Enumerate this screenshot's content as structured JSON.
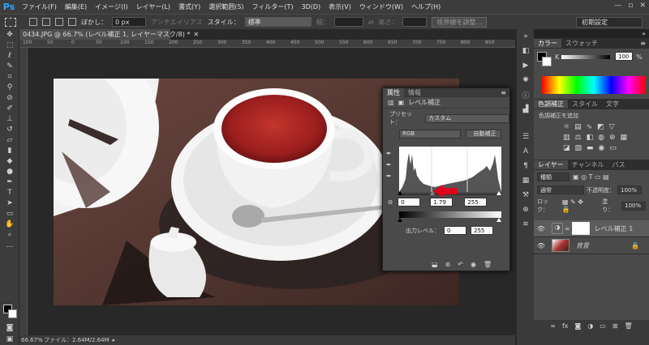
{
  "app": {
    "logo": "Ps"
  },
  "menu": [
    "ファイル(F)",
    "編集(E)",
    "イメージ(I)",
    "レイヤー(L)",
    "書式(Y)",
    "選択範囲(S)",
    "フィルター(T)",
    "3D(D)",
    "表示(V)",
    "ウィンドウ(W)",
    "ヘルプ(H)"
  ],
  "window_controls": [
    "—",
    "▫",
    "✕"
  ],
  "options": {
    "feather_label": "ぼかし：",
    "feather_value": "0 px",
    "antialias": "アンチエイリアス",
    "style_label": "スタイル：",
    "style_value": "標準",
    "width_label": "幅：",
    "height_label": "高さ：",
    "refine": "境界線を調整...",
    "workspace": "初期設定"
  },
  "document": {
    "tab": "0434.JPG @ 66.7% (レベル補正 1, レイヤーマスク/8) *",
    "status": "ファイル：2.64M/2.64M",
    "zoom": "66.67%"
  },
  "ruler": [
    "100",
    "50",
    "0",
    "50",
    "100",
    "150",
    "200",
    "250",
    "300",
    "350",
    "400",
    "450",
    "500",
    "550",
    "600",
    "650",
    "700",
    "750",
    "800",
    "850"
  ],
  "properties": {
    "tabs": [
      "属性",
      "情報"
    ],
    "title": "レベル補正",
    "preset_label": "プリセット：",
    "preset_value": "カスタム",
    "channel": "RGB",
    "auto_button": "自動補正",
    "input_black": "0",
    "input_gamma": "1.79",
    "input_white": "255",
    "output_label": "出力レベル：",
    "output_black": "0",
    "output_white": "255"
  },
  "color_panel": {
    "tabs": [
      "カラー",
      "スウォッチ"
    ],
    "channel": "K",
    "value": "100",
    "unit": "%"
  },
  "adjust_panel": {
    "tabs": [
      "色調補正",
      "スタイル",
      "文字"
    ],
    "title": "色調補正を追加"
  },
  "layers_panel": {
    "tabs": [
      "レイヤー",
      "チャンネル",
      "パス"
    ],
    "filter": "種類",
    "blend": "通常",
    "opacity_label": "不透明度：",
    "opacity": "100%",
    "lock_label": "ロック：",
    "fill_label": "塗り：",
    "fill": "100%",
    "layers": [
      "レベル補正 1",
      "背景"
    ]
  },
  "colors": {
    "accent": "#31a8ff",
    "highlight": "#e0001b"
  }
}
